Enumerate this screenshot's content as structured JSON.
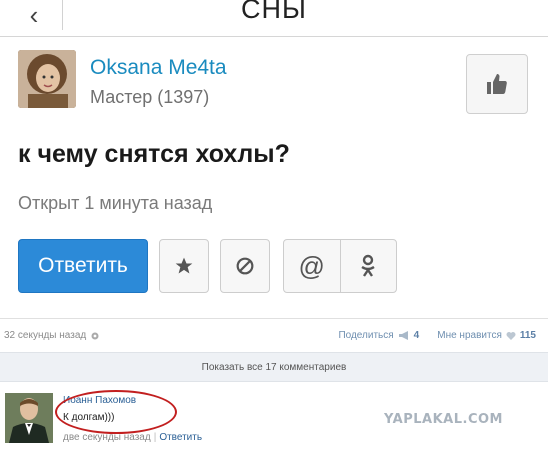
{
  "header": {
    "back_label": "‹",
    "title": "СНЫ"
  },
  "author": {
    "name": "Oksana Me4ta",
    "rank": "Мастер (1397)"
  },
  "question": {
    "title": "к чему снятся хохлы?",
    "status": "Открыт 1 минута назад"
  },
  "actions": {
    "reply_label": "Ответить",
    "icons": [
      "star-icon",
      "block-icon",
      "at-icon",
      "odnoklassniki-icon"
    ]
  },
  "meta": {
    "time": "32 секунды назад",
    "share_label": "Поделиться",
    "share_count": "4",
    "likes_label": "Мне нравится",
    "likes_count": "115"
  },
  "comments_bar": {
    "label": "Показать все 17 комментариев"
  },
  "comment": {
    "author": "Иоанн Пахомов",
    "text": "К долгам)))",
    "time": "две секунды назад",
    "reply_label": "Ответить"
  },
  "watermark": "YAPLAKAL.COM",
  "colors": {
    "accent": "#2c8ad8",
    "link": "#1a8bbf",
    "highlight_oval": "#c21f1f"
  }
}
